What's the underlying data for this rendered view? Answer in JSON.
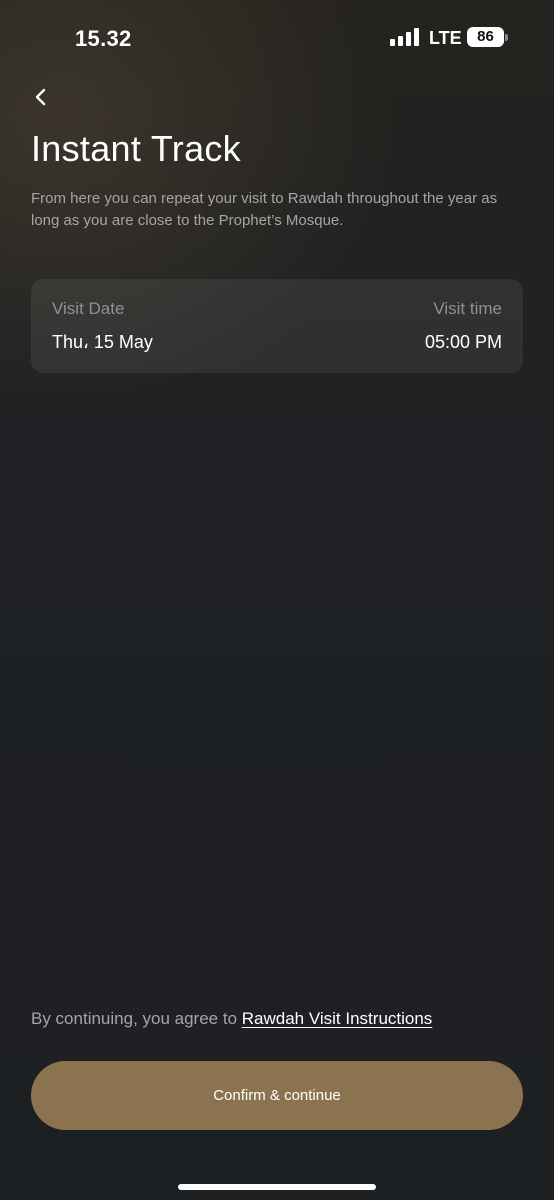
{
  "status_bar": {
    "time": "15.32",
    "network": "LTE",
    "battery": "86"
  },
  "header": {
    "back_icon": "chevron-left-icon",
    "title": "Instant Track",
    "description": "From here you can repeat your visit to Rawdah throughout the year as long as you are close to the Prophet’s Mosque."
  },
  "visit_card": {
    "date_label": "Visit Date",
    "date_value": "Thu، 15 May",
    "time_label": "Visit time",
    "time_value": "05:00 PM"
  },
  "footer": {
    "agreement_prefix": "By continuing, you agree to ",
    "agreement_link": "Rawdah Visit Instructions",
    "confirm_label": "Confirm & continue"
  },
  "colors": {
    "accent": "#8c7350",
    "background": "#1d2023",
    "card": "#2a2c2f"
  }
}
